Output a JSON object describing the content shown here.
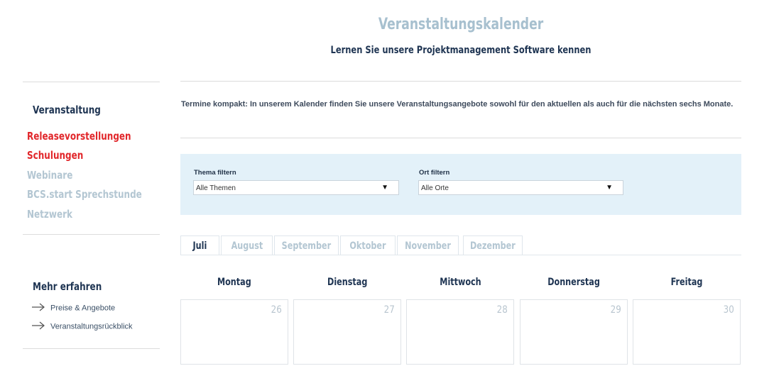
{
  "header": {
    "title": "Veranstaltungskalender",
    "subtitle": "Lernen Sie unsere Projektmanagement Software kennen"
  },
  "sidebar": {
    "heading": "Veranstaltung",
    "items": [
      {
        "label": "Releasevorstellungen",
        "state": "active"
      },
      {
        "label": "Schulungen",
        "state": "active"
      },
      {
        "label": "Webinare",
        "state": "inactive"
      },
      {
        "label": "BCS.start Sprechstunde",
        "state": "inactive"
      },
      {
        "label": "Netzwerk",
        "state": "inactive"
      }
    ],
    "more_heading": "Mehr erfahren",
    "more_items": [
      {
        "label": "Preise & Angebote",
        "icon": "arrow-right-icon"
      },
      {
        "label": "Veranstaltungsrückblick",
        "icon": "arrow-right-icon"
      }
    ]
  },
  "intro": "Termine kompakt: In unserem Kalender finden Sie unsere Veranstaltungsangebote sowohl für den aktuellen als auch für die nächsten sechs Monate.",
  "filters": {
    "topic": {
      "label": "Thema filtern",
      "value": "Alle Themen"
    },
    "location": {
      "label": "Ort filtern",
      "value": "Alle Orte"
    },
    "caret": "▼"
  },
  "tabs": [
    {
      "label": "Juli",
      "active": true
    },
    {
      "label": "August",
      "active": false
    },
    {
      "label": "September",
      "active": false
    },
    {
      "label": "Oktober",
      "active": false
    },
    {
      "label": "November",
      "active": false
    },
    {
      "label": "Dezember",
      "active": false
    }
  ],
  "weekdays": [
    "Montag",
    "Dienstag",
    "Mittwoch",
    "Donnerstag",
    "Freitag"
  ],
  "dates": [
    "26",
    "27",
    "28",
    "29",
    "30"
  ],
  "colors": {
    "title": "#a7c0cf",
    "navy": "#1e3452",
    "red": "#e1262a",
    "inactive": "#b3c6d2",
    "filter_bg": "#e3f1f9"
  }
}
